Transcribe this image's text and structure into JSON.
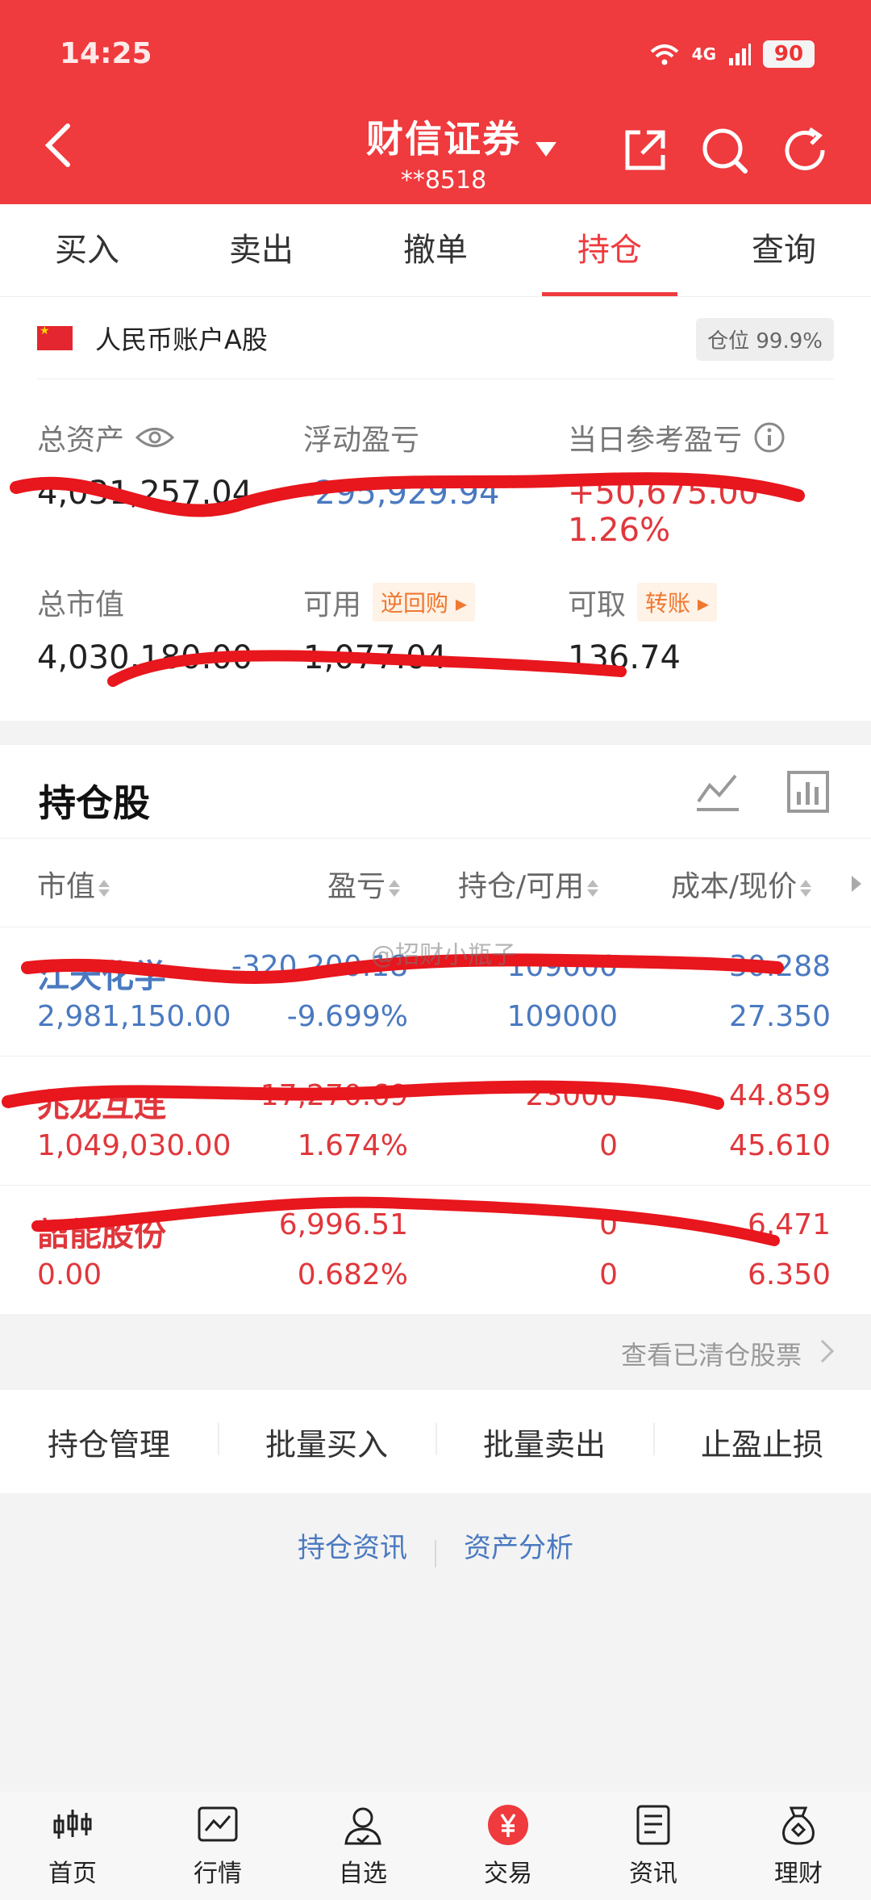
{
  "status_bar": {
    "time": "14:25",
    "network": "4G",
    "battery": "90"
  },
  "header": {
    "title": "财信证券",
    "account": "**8518"
  },
  "tabs": [
    {
      "label": "买入",
      "active": false
    },
    {
      "label": "卖出",
      "active": false
    },
    {
      "label": "撤单",
      "active": false
    },
    {
      "label": "持仓",
      "active": true
    },
    {
      "label": "查询",
      "active": false
    }
  ],
  "account": {
    "name": "人民币账户A股",
    "position_badge": "仓位 99.9%",
    "total_assets_label": "总资产",
    "total_assets_value": "4,031,257.04",
    "floating_pl_label": "浮动盈亏",
    "floating_pl_value": "-295,929.94",
    "daily_pl_label": "当日参考盈亏",
    "daily_pl_value": "+50,675.00 1.26%",
    "market_value_label": "总市值",
    "market_value_value": "4,030,180.00",
    "available_label": "可用",
    "available_value": "1,077.04",
    "reverse_repo_chip": "逆回购",
    "withdrawable_label": "可取",
    "withdrawable_value": "136.74",
    "transfer_chip": "转账"
  },
  "holdings": {
    "title": "持仓股",
    "columns": [
      "市值",
      "盈亏",
      "持仓/可用",
      "成本/现价"
    ],
    "rows": [
      {
        "name": "江天化学",
        "pl": "-320,200.18",
        "hold": "109000",
        "cost": "30.288",
        "market_value": "2,981,150.00",
        "pl_pct": "-9.699%",
        "available": "109000",
        "price": "27.350",
        "tone": "blue"
      },
      {
        "name": "兆龙互连",
        "pl": "17,270.69",
        "hold": "23000",
        "cost": "44.859",
        "market_value": "1,049,030.00",
        "pl_pct": "1.674%",
        "available": "0",
        "price": "45.610",
        "tone": "red"
      },
      {
        "name": "韶能股份",
        "pl": "6,996.51",
        "hold": "0",
        "cost": "6.471",
        "market_value": "0.00",
        "pl_pct": "0.682%",
        "available": "0",
        "price": "6.350",
        "tone": "red"
      }
    ]
  },
  "cleared_link": "查看已清仓股票",
  "actions": [
    "持仓管理",
    "批量买入",
    "批量卖出",
    "止盈止损"
  ],
  "links": [
    "持仓资讯",
    "资产分析"
  ],
  "watermark": "@招财小瓶子",
  "nav": [
    {
      "label": "首页",
      "icon": "candlestick-icon"
    },
    {
      "label": "行情",
      "icon": "chart-icon"
    },
    {
      "label": "自选",
      "icon": "user-icon"
    },
    {
      "label": "交易",
      "icon": "yuan-icon",
      "active": true
    },
    {
      "label": "资讯",
      "icon": "document-icon"
    },
    {
      "label": "理财",
      "icon": "moneybag-icon"
    }
  ],
  "colors": {
    "brand": "#ef3a3e",
    "loss": "#4a79c0",
    "gain": "#e0373c"
  }
}
